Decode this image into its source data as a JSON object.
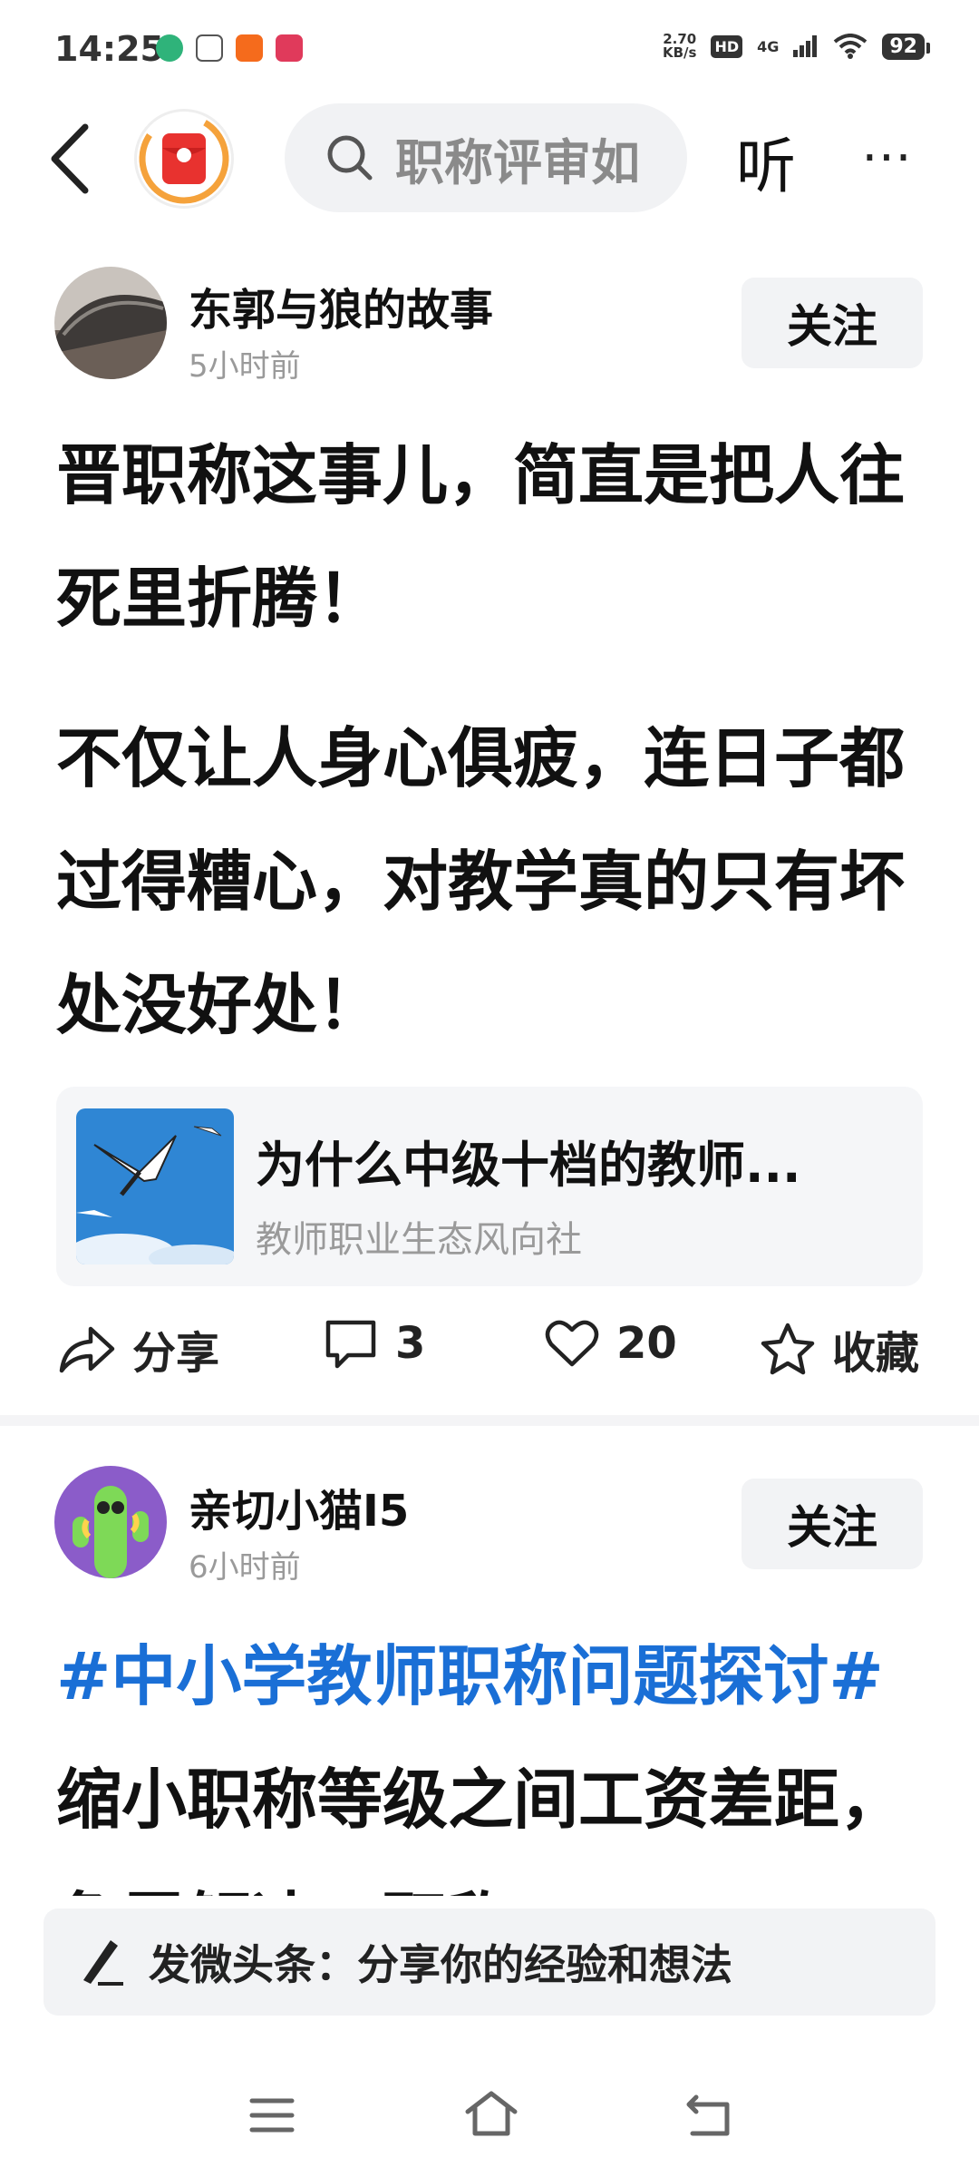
{
  "status_bar": {
    "time": "14:25",
    "net_speed_value": "2.70",
    "net_speed_unit": "KB/s",
    "hd_badge": "HD",
    "network": "4G",
    "battery": "92"
  },
  "top_bar": {
    "search_placeholder": "职称评审如",
    "listen_label": "听",
    "more_label": "⋯"
  },
  "posts": [
    {
      "username": "东郭与狼的故事",
      "time": "5小时前",
      "follow_label": "关注",
      "paragraph_1": "晋职称这事儿，简直是把人往死里折腾！",
      "paragraph_2": "不仅让人身心俱疲，连日子都过得糟心，对教学真的只有坏处没好处！",
      "link_card": {
        "title": "为什么中级十档的教师...",
        "source": "教师职业生态风向社"
      },
      "actions": {
        "share": "分享",
        "comments": "3",
        "likes": "20",
        "favorite": "收藏"
      }
    },
    {
      "username": "亲切小猫I5",
      "time": "6小时前",
      "follow_label": "关注",
      "hashtag": "#中小学教师职称问题探讨#",
      "text": "缩小职称等级之间工资差距，急需解决；职称"
    }
  ],
  "compose": {
    "placeholder": "发微头条：分享你的经验和想法"
  },
  "colors": {
    "accent_blue": "#1a6fd6",
    "logo_red": "#e8322f",
    "logo_ring": "#f5a23b"
  }
}
